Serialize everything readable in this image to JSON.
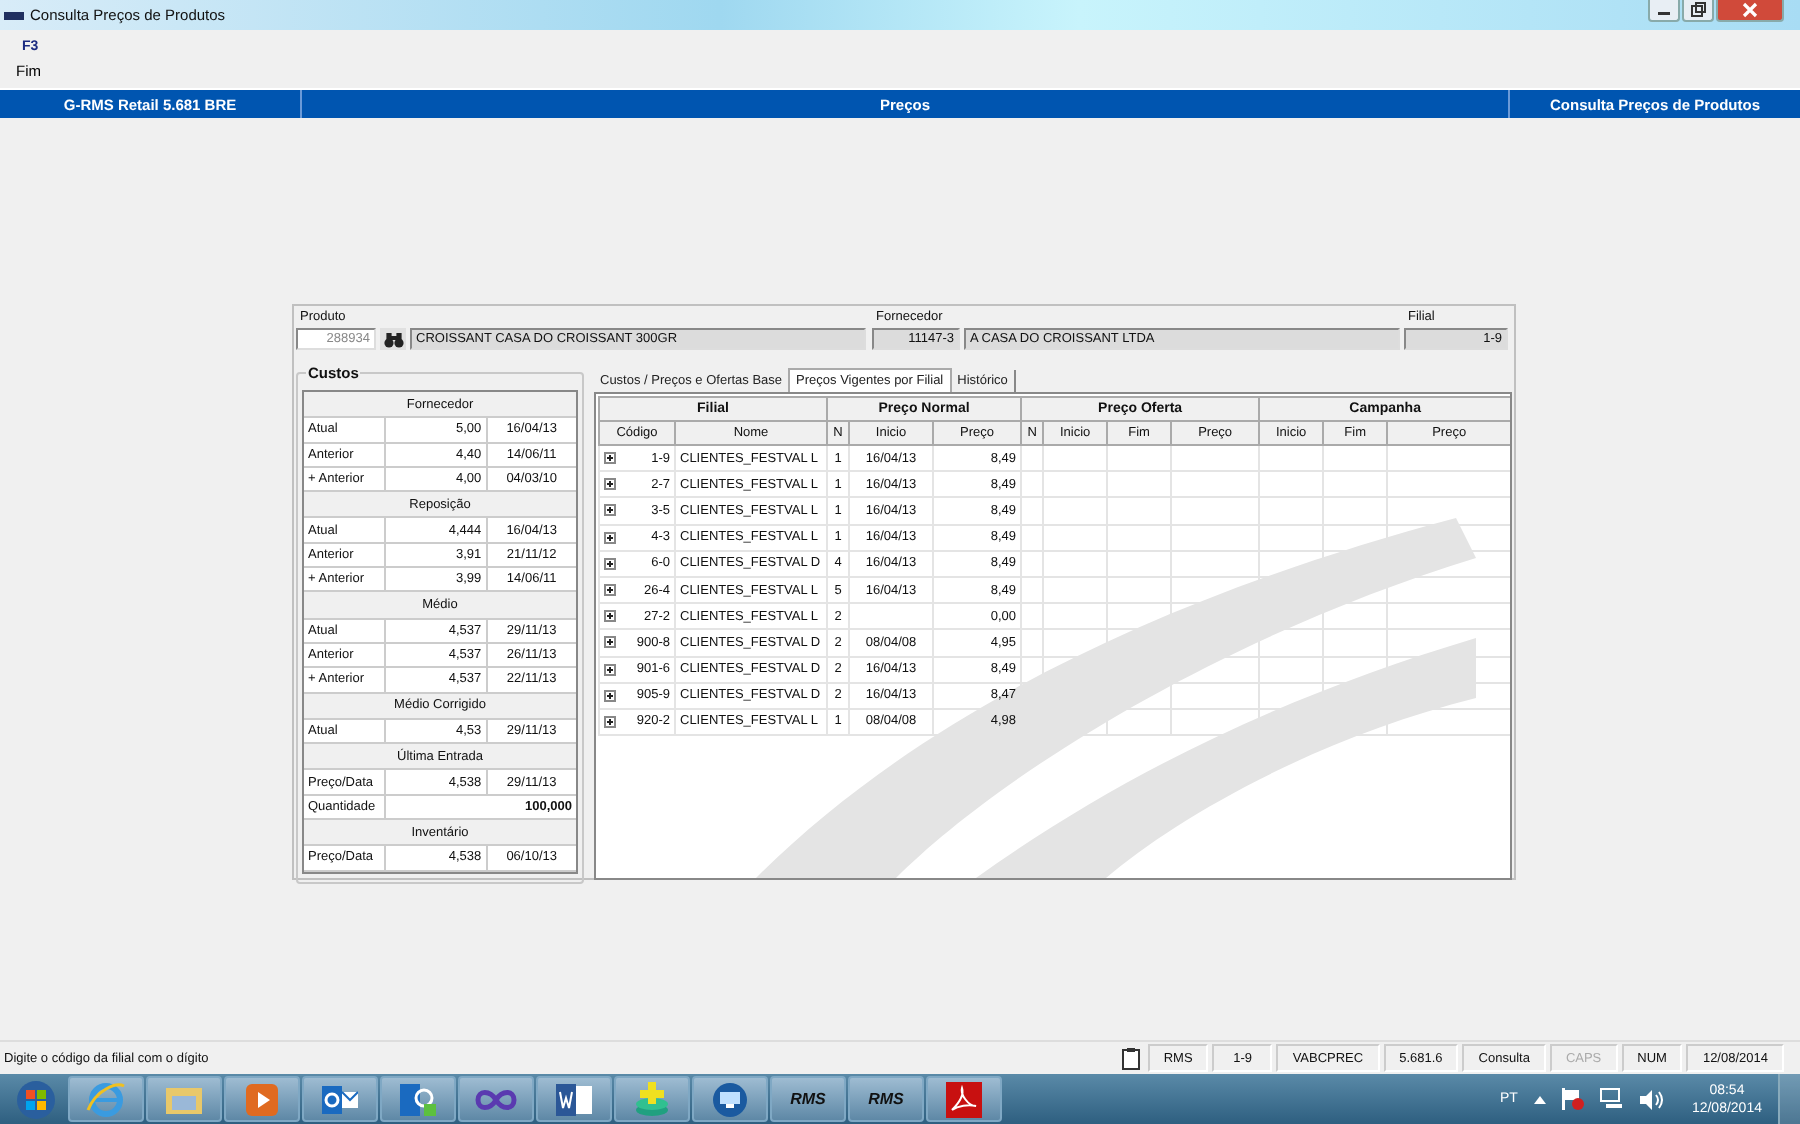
{
  "window": {
    "title": "Consulta Preços de Produtos"
  },
  "toolbar": [
    {
      "key": "F3",
      "label": "Fim"
    }
  ],
  "header": [
    "G-RMS Retail 5.681 BRE",
    "Preços",
    "Consulta Preços de Produtos"
  ],
  "produto": {
    "label": "Produto",
    "code": "288934",
    "description": "CROISSANT CASA DO CROISSANT 300GR"
  },
  "fornecedor": {
    "label": "Fornecedor",
    "code": "11147-3",
    "name": "A CASA DO CROISSANT LTDA"
  },
  "filial": {
    "label": "Filial",
    "value": "1-9"
  },
  "custos": {
    "title": "Custos",
    "sections": [
      {
        "title": "Fornecedor",
        "rows": [
          {
            "label": "Atual",
            "value": "5,00",
            "date": "16/04/13"
          },
          {
            "label": "Anterior",
            "value": "4,40",
            "date": "14/06/11"
          },
          {
            "label": "+ Anterior",
            "value": "4,00",
            "date": "04/03/10"
          }
        ]
      },
      {
        "title": "Reposição",
        "rows": [
          {
            "label": "Atual",
            "value": "4,444",
            "date": "16/04/13"
          },
          {
            "label": "Anterior",
            "value": "3,91",
            "date": "21/11/12"
          },
          {
            "label": "+ Anterior",
            "value": "3,99",
            "date": "14/06/11"
          }
        ]
      },
      {
        "title": "Médio",
        "rows": [
          {
            "label": "Atual",
            "value": "4,537",
            "date": "29/11/13"
          },
          {
            "label": "Anterior",
            "value": "4,537",
            "date": "26/11/13"
          },
          {
            "label": "+ Anterior",
            "value": "4,537",
            "date": "22/11/13"
          }
        ]
      },
      {
        "title": "Médio Corrigido",
        "rows": [
          {
            "label": "Atual",
            "value": "4,53",
            "date": "29/11/13"
          }
        ]
      },
      {
        "title": "Última Entrada",
        "rows": [
          {
            "label": "Preço/Data",
            "value": "4,538",
            "date": "29/11/13"
          },
          {
            "label": "Quantidade",
            "value": "100,000"
          }
        ]
      },
      {
        "title": "Inventário",
        "rows": [
          {
            "label": "Preço/Data",
            "value": "4,538",
            "date": "06/10/13"
          }
        ]
      }
    ]
  },
  "tabs": [
    {
      "label": "Custos / Preços e Ofertas Base",
      "selected": false
    },
    {
      "label": "Preços Vigentes por Filial",
      "selected": true
    },
    {
      "label": "Histórico",
      "selected": false
    }
  ],
  "table": {
    "groups": [
      {
        "label": "Filial",
        "columns": [
          "Código",
          "Nome"
        ]
      },
      {
        "label": "Preço Normal",
        "columns": [
          "N",
          "Inicio",
          "Preço"
        ]
      },
      {
        "label": "Preço Oferta",
        "columns": [
          "N",
          "Inicio",
          "Fim",
          "Preço"
        ]
      },
      {
        "label": "Campanha",
        "columns": [
          "Inicio",
          "Fim",
          "Preço"
        ]
      }
    ],
    "rows": [
      {
        "expanded": false,
        "cells": [
          "1-9",
          "CLIENTES_FESTVAL L",
          "1",
          "16/04/13",
          "8,49"
        ]
      },
      {
        "expanded": false,
        "cells": [
          "2-7",
          "CLIENTES_FESTVAL L",
          "1",
          "16/04/13",
          "8,49"
        ]
      },
      {
        "expanded": false,
        "cells": [
          "3-5",
          "CLIENTES_FESTVAL L",
          "1",
          "16/04/13",
          "8,49"
        ]
      },
      {
        "expanded": false,
        "cells": [
          "4-3",
          "CLIENTES_FESTVAL L",
          "1",
          "16/04/13",
          "8,49"
        ]
      },
      {
        "expanded": false,
        "cells": [
          "6-0",
          "CLIENTES_FESTVAL D",
          "4",
          "16/04/13",
          "8,49"
        ]
      },
      {
        "expanded": false,
        "cells": [
          "26-4",
          "CLIENTES_FESTVAL L",
          "5",
          "16/04/13",
          "8,49"
        ]
      },
      {
        "expanded": false,
        "cells": [
          "27-2",
          "CLIENTES_FESTVAL L",
          "2",
          "",
          "0,00"
        ]
      },
      {
        "expanded": false,
        "cells": [
          "900-8",
          "CLIENTES_FESTVAL D",
          "2",
          "08/04/08",
          "4,95"
        ]
      },
      {
        "expanded": false,
        "cells": [
          "901-6",
          "CLIENTES_FESTVAL D",
          "2",
          "16/04/13",
          "8,49"
        ]
      },
      {
        "expanded": false,
        "cells": [
          "905-9",
          "CLIENTES_FESTVAL D",
          "2",
          "16/04/13",
          "8,47"
        ]
      },
      {
        "expanded": false,
        "cells": [
          "920-2",
          "CLIENTES_FESTVAL L",
          "1",
          "08/04/08",
          "4,98"
        ]
      }
    ]
  },
  "status_bar": {
    "message": "Digite o código da filial com o dígito",
    "cells": [
      {
        "text": "RMS",
        "disabled": false
      },
      {
        "text": "1-9",
        "disabled": false
      },
      {
        "text": "VABCPREC",
        "disabled": false
      },
      {
        "text": "5.681.6",
        "disabled": false
      },
      {
        "text": "Consulta",
        "disabled": false
      },
      {
        "text": "CAPS",
        "disabled": true
      },
      {
        "text": "NUM",
        "disabled": false
      },
      {
        "text": "12/08/2014",
        "disabled": false
      }
    ]
  },
  "taskbar": {
    "items": [
      {
        "kind": "browser"
      },
      {
        "kind": "folder"
      },
      {
        "kind": "media"
      },
      {
        "kind": "mail"
      },
      {
        "kind": "chat"
      },
      {
        "kind": "infinity"
      },
      {
        "kind": "word"
      },
      {
        "kind": "database"
      },
      {
        "kind": "remote"
      },
      {
        "kind": "rms",
        "label": "RMS"
      },
      {
        "kind": "rms",
        "label": "RMS"
      },
      {
        "kind": "pdf"
      }
    ],
    "language": "PT",
    "time": "08:54",
    "date": "12/08/2014"
  }
}
